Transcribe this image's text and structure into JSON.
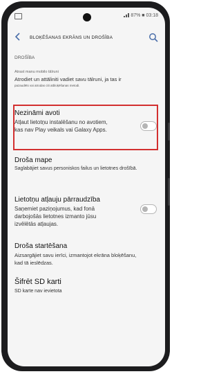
{
  "status_bar": {
    "battery_time": "87% ■ 03:18"
  },
  "header": {
    "title": "BLOĶĒŠANAS EKRĀNS UN DROŠĪBA"
  },
  "section": {
    "label": "DROŠĪBA"
  },
  "find_device": {
    "title": "Atrast manu mobilo tālruni",
    "desc": "Atrodiet un attāliniti vadiet savu tālruni, ja tas ir",
    "desc2": "pazaudēts vai atrodas citi atbloķēšanas metodi."
  },
  "unknown_sources": {
    "title": "Nezināmi avoti",
    "desc": "Atļaut lietotņu instalēšanu no avotiem, kas nav Play veikals vai Galaxy Apps.",
    "enabled": false
  },
  "secure_folder": {
    "title": "Droša mape",
    "desc": "Saglabājiet savus personiskos failus un lietotnes drošībā."
  },
  "permission_monitor": {
    "title": "Lietotņu atļauju pārraudzība",
    "desc": "Saņemiet paziņojumus, kad fonā darbojošās lietotnes izmanto jūsu izvēlētās atļaujas.",
    "enabled": false
  },
  "secure_startup": {
    "title": "Droša startēšana",
    "desc": "Aizsargājiet savu ierīci, izmantojot ekrāna bloķēšanu, kad tā ieslēdzas."
  },
  "encrypt_sd": {
    "title": "Šifrēt SD karti",
    "desc": "SD karte nav ievietota"
  },
  "colors": {
    "accent": "#4a6ea9",
    "highlight": "#d32f2f"
  }
}
